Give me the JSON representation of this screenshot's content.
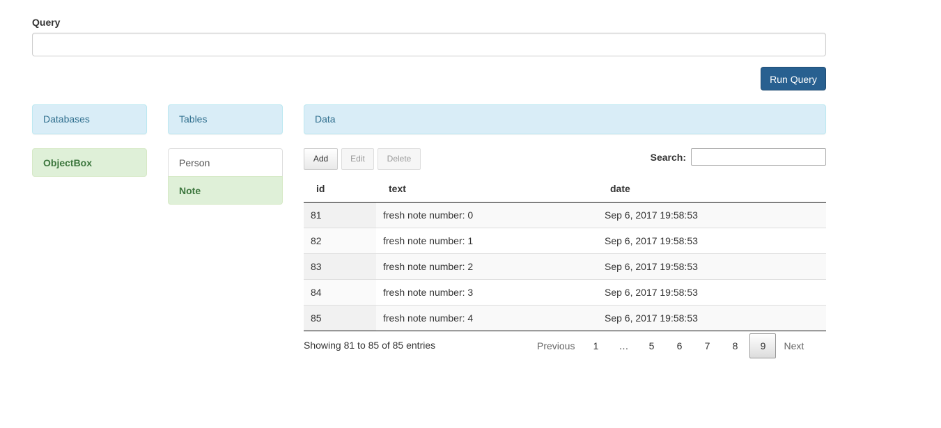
{
  "query": {
    "label": "Query",
    "value": "",
    "placeholder": ""
  },
  "run_button": "Run Query",
  "panels": {
    "databases": "Databases",
    "tables": "Tables",
    "data": "Data"
  },
  "databases": [
    "ObjectBox"
  ],
  "tables": [
    "Person",
    "Note"
  ],
  "toolbar": {
    "add": "Add",
    "edit": "Edit",
    "delete": "Delete"
  },
  "search": {
    "label": "Search:",
    "value": ""
  },
  "table": {
    "headers": [
      "id",
      "text",
      "date"
    ],
    "rows": [
      [
        "81",
        "fresh note number: 0",
        "Sep 6, 2017 19:58:53"
      ],
      [
        "82",
        "fresh note number: 1",
        "Sep 6, 2017 19:58:53"
      ],
      [
        "83",
        "fresh note number: 2",
        "Sep 6, 2017 19:58:53"
      ],
      [
        "84",
        "fresh note number: 3",
        "Sep 6, 2017 19:58:53"
      ],
      [
        "85",
        "fresh note number: 4",
        "Sep 6, 2017 19:58:53"
      ]
    ]
  },
  "info": "Showing 81 to 85 of 85 entries",
  "pagination": {
    "previous": "Previous",
    "pages": [
      "1",
      "…",
      "5",
      "6",
      "7",
      "8",
      "9"
    ],
    "current": "9",
    "next": "Next"
  },
  "colors": {
    "primary": "#286090",
    "info_bg": "#d9edf7",
    "success_bg": "#dff0d8",
    "success_text": "#3c763d"
  }
}
